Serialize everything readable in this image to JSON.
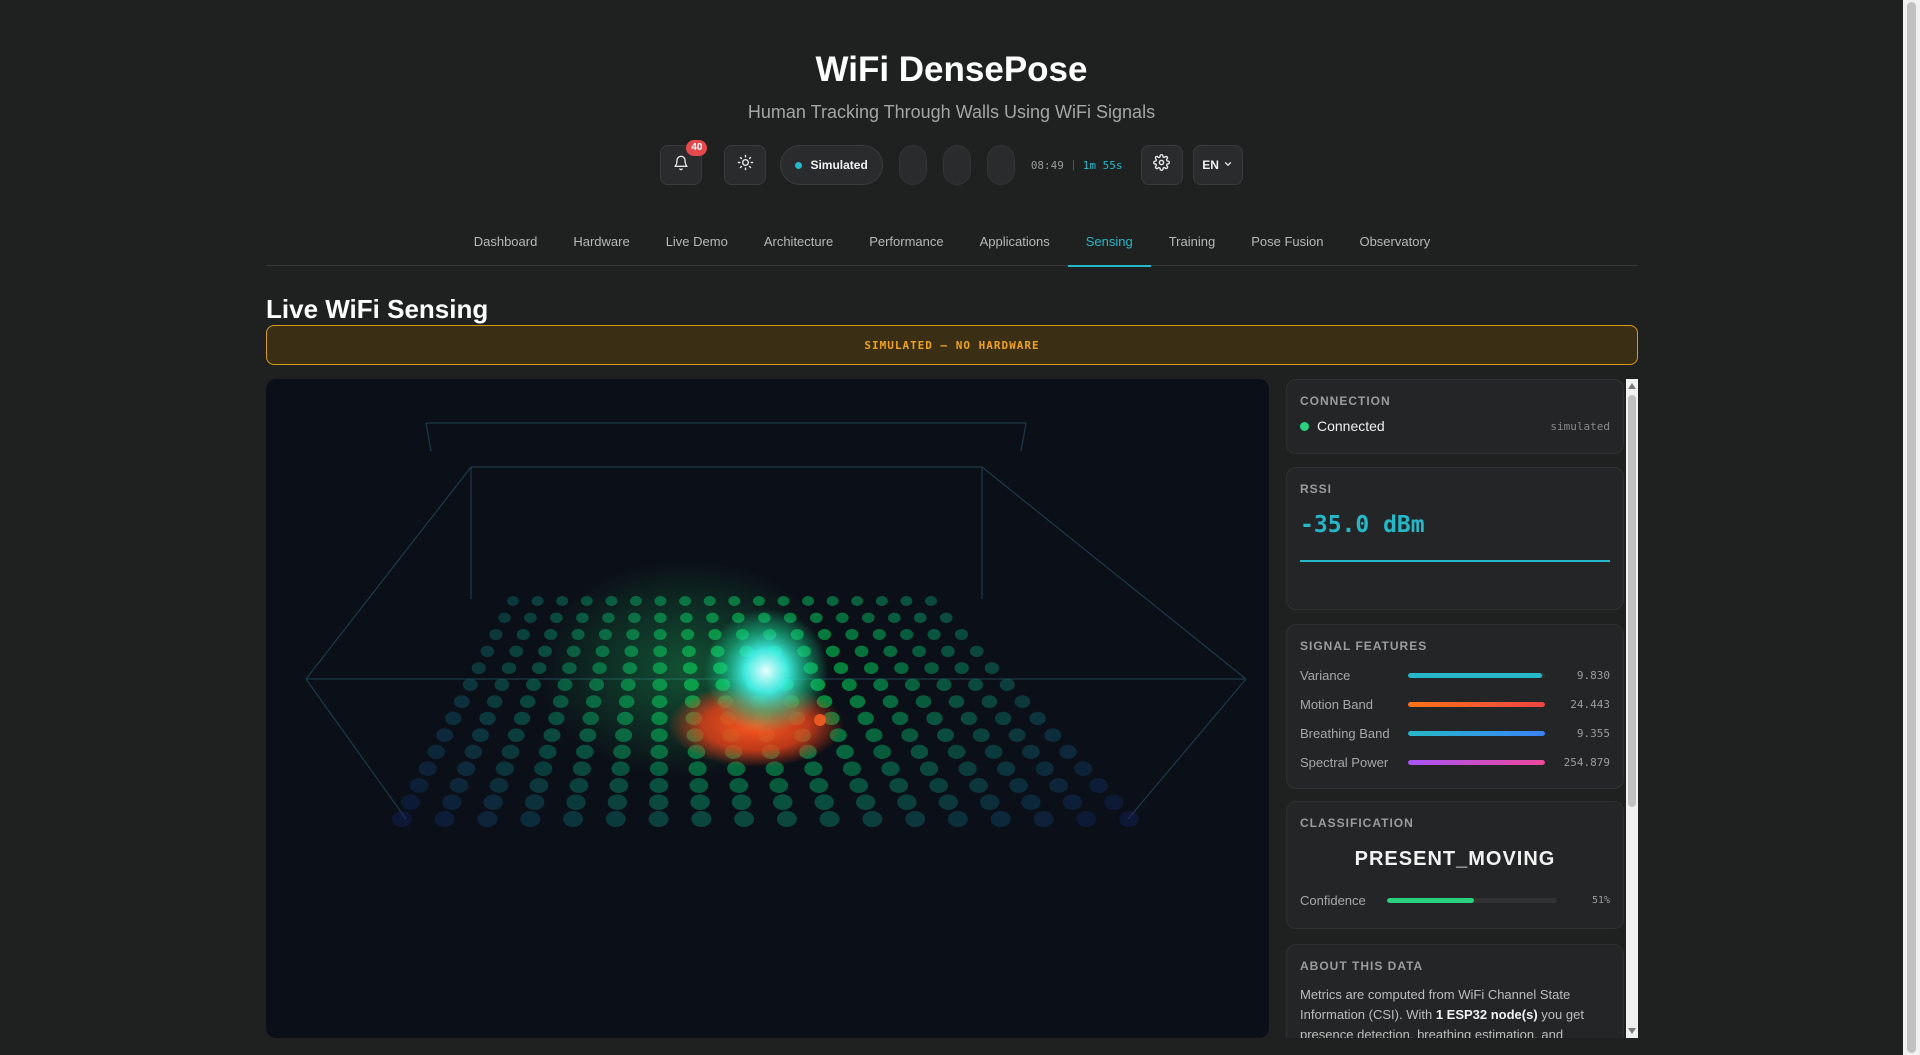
{
  "header": {
    "title": "WiFi DensePose",
    "subtitle": "Human Tracking Through Walls Using WiFi Signals"
  },
  "controls": {
    "notifications_count": "40",
    "mode_label": "Simulated",
    "clock": "08:49",
    "uptime": "1m 55s",
    "language": "EN"
  },
  "nav": {
    "tabs": [
      {
        "label": "Dashboard"
      },
      {
        "label": "Hardware"
      },
      {
        "label": "Live Demo"
      },
      {
        "label": "Architecture"
      },
      {
        "label": "Performance"
      },
      {
        "label": "Applications"
      },
      {
        "label": "Sensing"
      },
      {
        "label": "Training"
      },
      {
        "label": "Pose Fusion"
      },
      {
        "label": "Observatory"
      }
    ],
    "active": "Sensing"
  },
  "section": {
    "title": "Live WiFi Sensing",
    "banner": "SIMULATED — NO HARDWARE"
  },
  "connection": {
    "title": "CONNECTION",
    "status": "Connected",
    "source": "simulated"
  },
  "rssi": {
    "title": "RSSI",
    "value": "-35.0 dBm"
  },
  "features": {
    "title": "SIGNAL FEATURES",
    "items": [
      {
        "label": "Variance",
        "value": "9.830",
        "fill": 0.98
      },
      {
        "label": "Motion Band",
        "value": "24.443",
        "fill": 1.0
      },
      {
        "label": "Breathing Band",
        "value": "9.355",
        "fill": 1.0
      },
      {
        "label": "Spectral Power",
        "value": "254.879",
        "fill": 1.0
      }
    ]
  },
  "classification": {
    "title": "CLASSIFICATION",
    "value": "PRESENT_MOVING",
    "confidence_label": "Confidence",
    "confidence_value": "51%",
    "confidence": 0.51
  },
  "about": {
    "title": "ABOUT THIS DATA",
    "text_before": "Metrics are computed from WiFi Channel State Information (CSI). With ",
    "text_bold": "1 ESP32 node(s)",
    "text_after": " you get presence detection, breathing estimation, and"
  },
  "colors": {
    "accent": "#26b8c9",
    "status_ok": "#2ad17e",
    "warning": "#f0a21e",
    "badge": "#e5484d",
    "variance": "#26b8c9",
    "motion": "#ef4444",
    "breathing": "#3b82f6",
    "spectral_start": "#a855f7",
    "spectral_end": "#ec4899"
  }
}
